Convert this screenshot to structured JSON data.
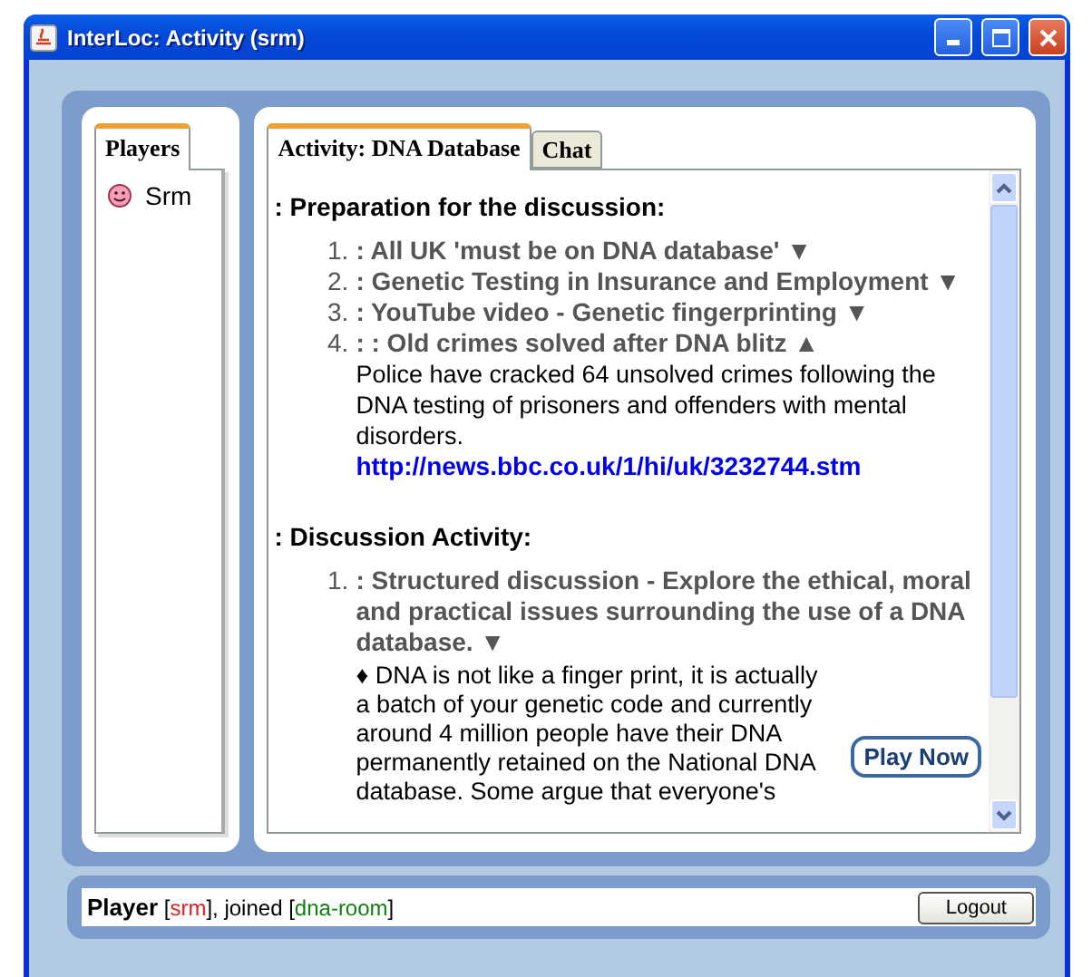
{
  "window": {
    "title": "InterLoc: Activity (srm)"
  },
  "players": {
    "tab": "Players",
    "items": [
      {
        "name": "Srm"
      }
    ]
  },
  "tabs": [
    {
      "label": "Activity: DNA Database",
      "selected": true
    },
    {
      "label": "Chat",
      "selected": false
    }
  ],
  "sections": [
    {
      "heading": ": Preparation for the discussion:",
      "items": [
        {
          "number": "1.",
          "title": ": All UK 'must be on DNA database'",
          "toggle": "▼"
        },
        {
          "number": "2.",
          "title": ": Genetic Testing in Insurance and Employment",
          "toggle": "▼"
        },
        {
          "number": "3.",
          "title": ": YouTube video - Genetic fingerprinting",
          "toggle": "▼"
        },
        {
          "number": "4.",
          "title": ": : Old crimes solved after DNA blitz",
          "toggle": "▲",
          "body": "Police have cracked 64 unsolved crimes following the DNA testing of prisoners and offenders with mental disorders.",
          "link": "http://news.bbc.co.uk/1/hi/uk/3232744.stm"
        }
      ]
    },
    {
      "heading": ": Discussion Activity:",
      "items": [
        {
          "number": "1.",
          "title": ": Structured discussion - Explore the ethical, moral and practical issues surrounding the use of a DNA database.",
          "toggle": "▼",
          "note": "♦ DNA is not like a finger print, it is actually a batch of your genetic code and currently around 4 million people have their DNA permanently retained on the National DNA database. Some argue that everyone's",
          "button": "Play Now"
        }
      ]
    }
  ],
  "status": {
    "parts": [
      {
        "kind": "label",
        "text": "Player"
      },
      {
        "kind": "plain",
        "text": " ["
      },
      {
        "kind": "user",
        "text": "srm"
      },
      {
        "kind": "plain",
        "text": "], joined ["
      },
      {
        "kind": "room",
        "text": "dna-room"
      },
      {
        "kind": "plain",
        "text": "]"
      }
    ],
    "button": "Logout"
  }
}
